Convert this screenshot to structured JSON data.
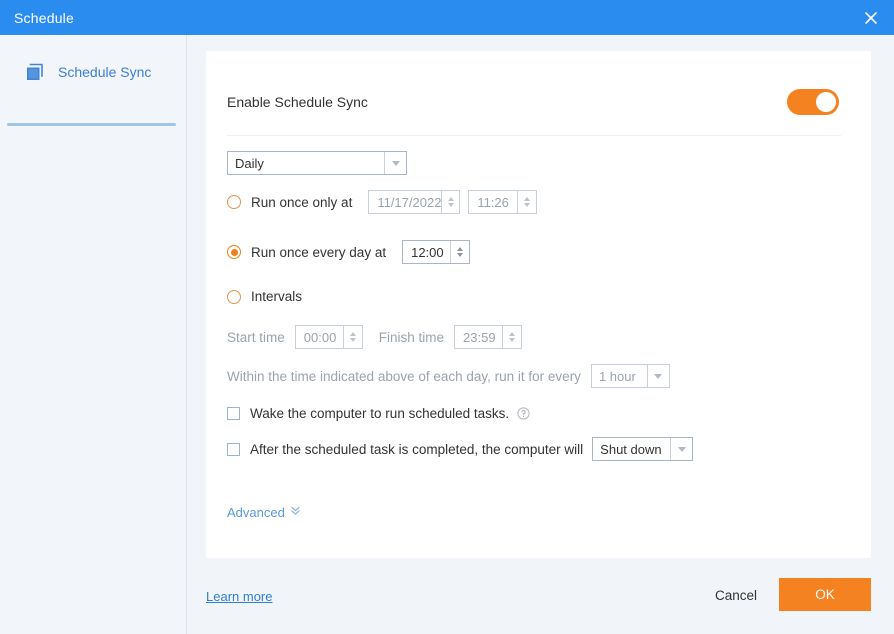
{
  "window": {
    "title": "Schedule",
    "close_icon": "close-icon"
  },
  "sidebar": {
    "items": [
      {
        "label": "Schedule Sync",
        "icon": "schedule-sync-icon",
        "active": true
      }
    ]
  },
  "main": {
    "enable": {
      "label": "Enable Schedule Sync",
      "toggle_on": true,
      "accent_color": "#f58220"
    },
    "frequency": {
      "selected": "Daily"
    },
    "run_once_only": {
      "label": "Run once only at",
      "selected": false,
      "date_value": "11/17/2022",
      "time_value": "11:26",
      "disabled": true
    },
    "run_every_day": {
      "label": "Run once every day at",
      "selected": true,
      "time_value": "12:00",
      "disabled": false
    },
    "intervals": {
      "label": "Intervals",
      "selected": false,
      "start_time_label": "Start time",
      "start_time_value": "00:00",
      "finish_time_label": "Finish time",
      "finish_time_value": "23:59",
      "every_prefix": "Within the time indicated above of each day, run it for every",
      "every_value": "1 hour",
      "disabled": true
    },
    "wake": {
      "label": "Wake the computer to run scheduled tasks.",
      "checked": false,
      "help_icon": "help-circle-icon"
    },
    "after_task": {
      "label": "After the scheduled task is completed, the computer will",
      "checked": false,
      "action_value": "Shut down"
    },
    "advanced": {
      "label": "Advanced",
      "icon": "double-chevron-down-icon"
    }
  },
  "footer": {
    "learn_more": "Learn more",
    "cancel": "Cancel",
    "ok": "OK"
  }
}
